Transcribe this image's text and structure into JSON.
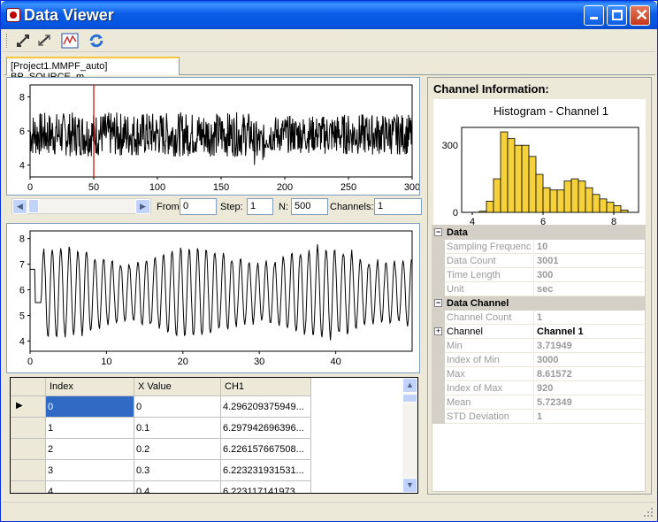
{
  "window": {
    "title": "Data Viewer"
  },
  "tab": {
    "label": "[Project1.MMPF_auto] BP_SOURCE_m"
  },
  "controls": {
    "from_label": "From:",
    "from_value": "0",
    "step_label": "Step:",
    "step_value": "1",
    "n_label": "N:",
    "n_value": "500",
    "channels_label": "Channels:",
    "channels_value": "1"
  },
  "plot1": {
    "yticks": [
      "8",
      "6",
      "4"
    ],
    "xticks": [
      "0",
      "50",
      "100",
      "150",
      "200",
      "250",
      "300"
    ],
    "cursor_x": 50
  },
  "plot2": {
    "yticks": [
      "8",
      "7",
      "6",
      "5",
      "4"
    ],
    "xticks": [
      "0",
      "10",
      "20",
      "30",
      "40"
    ]
  },
  "grid": {
    "headers": [
      "Index",
      "X Value",
      "CH1"
    ],
    "rows": [
      [
        "0",
        "0",
        "4.296209375949..."
      ],
      [
        "1",
        "0.1",
        "6.297942696396..."
      ],
      [
        "2",
        "0.2",
        "6.226157667508..."
      ],
      [
        "3",
        "0.3",
        "6.223231931531..."
      ],
      [
        "4",
        "0.4",
        "6.223117141973..."
      ]
    ]
  },
  "info": {
    "heading": "Channel Information:",
    "histogram": {
      "title": "Histogram - Channel 1",
      "yticks": [
        "300",
        "0"
      ],
      "xticks": [
        "4",
        "6",
        "8"
      ]
    },
    "data_cat": "Data",
    "data_rows": [
      {
        "k": "Sampling Frequenc",
        "v": "10"
      },
      {
        "k": "Data Count",
        "v": "3001"
      },
      {
        "k": "Time Length",
        "v": "300"
      },
      {
        "k": "Unit",
        "v": "sec"
      }
    ],
    "channel_cat": "Data Channel",
    "channel_count": {
      "k": "Channel Count",
      "v": "1"
    },
    "channel": {
      "k": "Channel",
      "v": "Channel 1"
    },
    "stats": [
      {
        "k": "Min",
        "v": "3.71949"
      },
      {
        "k": "Index of Min",
        "v": "3000"
      },
      {
        "k": "Max",
        "v": "8.61572"
      },
      {
        "k": "Index of Max",
        "v": "920"
      },
      {
        "k": "Mean",
        "v": "5.72349"
      },
      {
        "k": "STD Deviation",
        "v": "1"
      }
    ]
  },
  "chart_data": [
    {
      "type": "histogram",
      "title": "Histogram - Channel 1",
      "bins_center": [
        4.3,
        4.5,
        4.7,
        4.9,
        5.1,
        5.3,
        5.5,
        5.7,
        5.9,
        6.1,
        6.3,
        6.5,
        6.7,
        6.9,
        7.1,
        7.3,
        7.5,
        7.7,
        7.9,
        8.1,
        8.3
      ],
      "counts": [
        5,
        50,
        150,
        360,
        330,
        300,
        300,
        250,
        170,
        110,
        100,
        100,
        140,
        150,
        140,
        110,
        80,
        60,
        45,
        30,
        10
      ],
      "xlim": [
        3.7,
        8.7
      ],
      "ylim": [
        0,
        380
      ]
    }
  ]
}
